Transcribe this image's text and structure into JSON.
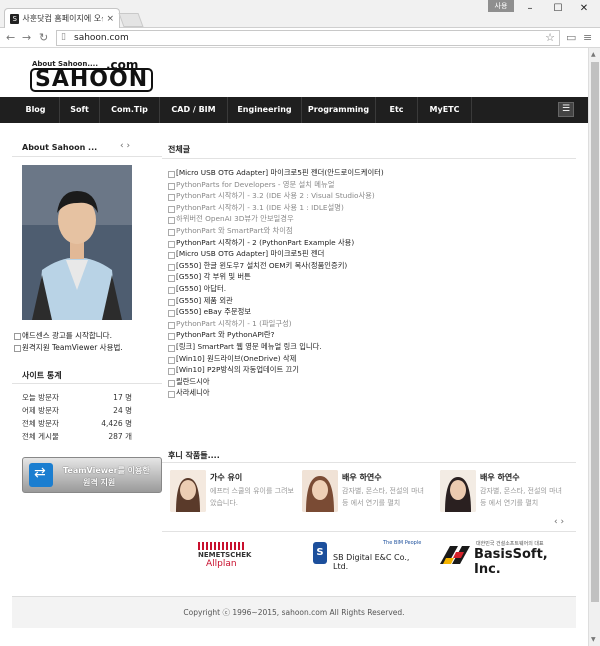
{
  "browser": {
    "tab_title": "사훈닷컴 홈페이지에 오신",
    "tab_favicon": "S",
    "url": "sahoon.com",
    "user_badge": "사용"
  },
  "logo": {
    "small": "About Sahoon....",
    "com": ".com",
    "main": "SAHOON"
  },
  "menu": [
    "Blog",
    "Soft",
    "Com.Tip",
    "CAD / BIM",
    "Engineering",
    "Programming",
    "Etc",
    "MyETC"
  ],
  "sidebar": {
    "about_title": "About Sahoon ...",
    "links": [
      "애드센스 광고를 시작합니다.",
      "원격지원 TeamViewer 사용법."
    ],
    "stats_title": "사이트 통계",
    "stats": [
      {
        "label": "오늘 방문자",
        "value": "17 명"
      },
      {
        "label": "어제 방문자",
        "value": "24 명"
      },
      {
        "label": "전체 방문자",
        "value": "4,426 명"
      },
      {
        "label": "전체 게시물",
        "value": "287 개"
      }
    ],
    "teamviewer_line1": "TeamViewer를 이용한",
    "teamviewer_line2": "원격 지원"
  },
  "main": {
    "title": "전체글",
    "posts": [
      {
        "text": "[Micro USB OTG Adapter] 마이크로5핀 젠더(안드로이드케이터)",
        "gray": false
      },
      {
        "text": "PythonParts for Developers - 영문 설치 메뉴얼",
        "gray": true
      },
      {
        "text": "PythonPart 시작하기 - 3.2 (IDE 사용 2 : Visual Studio사용)",
        "gray": true
      },
      {
        "text": "PythonPart 시작하기 - 3.1 (IDE 사용 1 : IDLE설명)",
        "gray": true
      },
      {
        "text": "하위버전 OpenAI 3D뷰가 안보일경우",
        "gray": true
      },
      {
        "text": "PythonPart 와 SmartPart와 차이점",
        "gray": true
      },
      {
        "text": "PythonPart 시작하기 - 2 (PythonPart Example 사용)",
        "gray": false
      },
      {
        "text": "[Micro USB OTG Adapter] 마이크로5핀 젠더",
        "gray": false
      },
      {
        "text": "[G550] 한글 윈도우7 설치전 OEM키 복사(정품인증키)",
        "gray": false
      },
      {
        "text": "[G550] 각 부위 및 버튼",
        "gray": false
      },
      {
        "text": "[G550] 아답터.",
        "gray": false
      },
      {
        "text": "[G550] 제품 외관",
        "gray": false
      },
      {
        "text": "[G550] eBay 주문정보",
        "gray": false
      },
      {
        "text": "PythonPart 시작하기 - 1 (파일구성)",
        "gray": true
      },
      {
        "text": "PythonPart 와 PythonAPI란?",
        "gray": false
      },
      {
        "text": "[링크] SmartPart 웹 영문 메뉴얼 링크 입니다.",
        "gray": false
      },
      {
        "text": "[Win10] 원드라이브(OneDrive) 삭제",
        "gray": false
      },
      {
        "text": "[Win10] P2P방식의 자동업데이트 끄기",
        "gray": false
      },
      {
        "text": "릴란드시아",
        "gray": false
      },
      {
        "text": "사라세니아",
        "gray": false
      }
    ],
    "works_title": "후니 작품들....",
    "works": [
      {
        "title": "가수 유이",
        "desc": "에프터 스쿨의 유이를 그려보았습니다."
      },
      {
        "title": "배우 하연수",
        "desc": "감자별, 몬스타, 전설의 마녀 등 에서 연기를 펼치"
      },
      {
        "title": "배우 하연수",
        "desc": "감자별, 몬스타, 전설의 마녀 등 에서 연기를 펼치"
      }
    ],
    "partners": [
      {
        "line1": "NEMETSCHEK",
        "line2": "Allplan"
      },
      {
        "line0": "The BIM People",
        "line1": "SB Digital E&C Co., Ltd."
      },
      {
        "line0": "대한민국 건설소프트웨어의 대표",
        "line1": "BasisSoft, Inc."
      }
    ]
  },
  "footer": {
    "text": "Copyright ⓒ 1996~2015, sahoon.com All Rights Reserved."
  }
}
